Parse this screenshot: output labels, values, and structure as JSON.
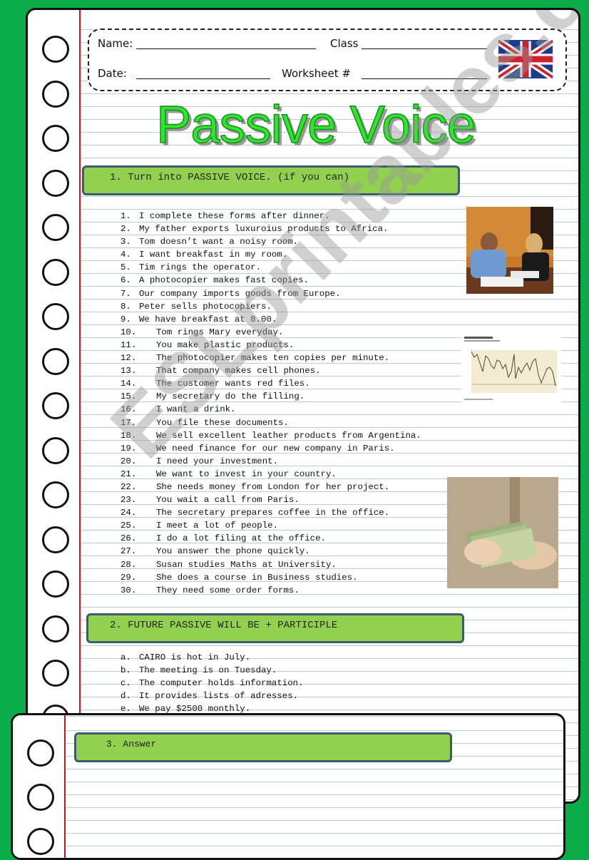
{
  "header": {
    "name_label": "Name:",
    "class_label": "Class",
    "date_label": "Date:",
    "worksheet_label": "Worksheet #",
    "flag": "uk-flag-icon"
  },
  "title": "Passive Voice",
  "watermark": "ESLprintables.com",
  "section1": {
    "heading": "1. Turn into PASSIVE VOICE. (if you can)",
    "items": [
      {
        "num": "1.",
        "text": "I complete these forms after dinner."
      },
      {
        "num": "2.",
        "text": "My father exports luxuroius products to Africa."
      },
      {
        "num": "3.",
        "text": "Tom doesn’t want a noisy room."
      },
      {
        "num": "4.",
        "text": "I want breakfast in my room."
      },
      {
        "num": "5.",
        "text": "Tim rings the operator."
      },
      {
        "num": "6.",
        "text": "A photocopier makes fast copies."
      },
      {
        "num": "7.",
        "text": "Our company imports goods from Europe."
      },
      {
        "num": "8.",
        "text": "Peter sells photocopiers."
      },
      {
        "num": "9.",
        "text": "We have breakfast at 8.00."
      },
      {
        "num": "10.",
        "text": "Tom rings Mary everyday."
      },
      {
        "num": "11.",
        "text": "You make plastic products."
      },
      {
        "num": "12.",
        "text": "The photocopier makes ten copies per minute."
      },
      {
        "num": "13.",
        "text": "That company makes cell phones."
      },
      {
        "num": "14.",
        "text": "The customer wants red files."
      },
      {
        "num": "15.",
        "text": "My secretary do the filling."
      },
      {
        "num": "16.",
        "text": "I want a drink."
      },
      {
        "num": "17.",
        "text": "You file these documents."
      },
      {
        "num": "18.",
        "text": "We sell excellent leather products from Argentina."
      },
      {
        "num": "19.",
        "text": "We need finance for our new company in Paris."
      },
      {
        "num": "20.",
        "text": "I need your investment."
      },
      {
        "num": "21.",
        "text": "We want to invest in your country."
      },
      {
        "num": "22.",
        "text": "She needs money from London for her project."
      },
      {
        "num": "23.",
        "text": "You wait a call from Paris."
      },
      {
        "num": "24.",
        "text": "The secretary prepares coffee in the office."
      },
      {
        "num": "25.",
        "text": "I meet a lot of people."
      },
      {
        "num": "26.",
        "text": "I do a lot filing at the office."
      },
      {
        "num": "27.",
        "text": "You answer the phone quickly."
      },
      {
        "num": "28.",
        "text": "Susan studies Maths at University."
      },
      {
        "num": "29.",
        "text": "She does a course in Business studies."
      },
      {
        "num": "30.",
        "text": "They need some order forms."
      }
    ]
  },
  "section2": {
    "heading": "2. FUTURE PASSIVE   WILL BE + PARTICIPLE",
    "items": [
      {
        "num": "a.",
        "text": "CAIRO is hot in July."
      },
      {
        "num": "b.",
        "text": "The meeting is on Tuesday."
      },
      {
        "num": "c.",
        "text": "The computer holds information."
      },
      {
        "num": "d.",
        "text": "It provides lists of adresses."
      },
      {
        "num": "e.",
        "text": "We pay $2500 monthly."
      }
    ]
  },
  "section3": {
    "heading": "3. Answer"
  },
  "images": {
    "photo1": "business-meeting-photo",
    "photo2": "line-chart-thumbnail",
    "photo3": "cash-in-hands-photo"
  }
}
